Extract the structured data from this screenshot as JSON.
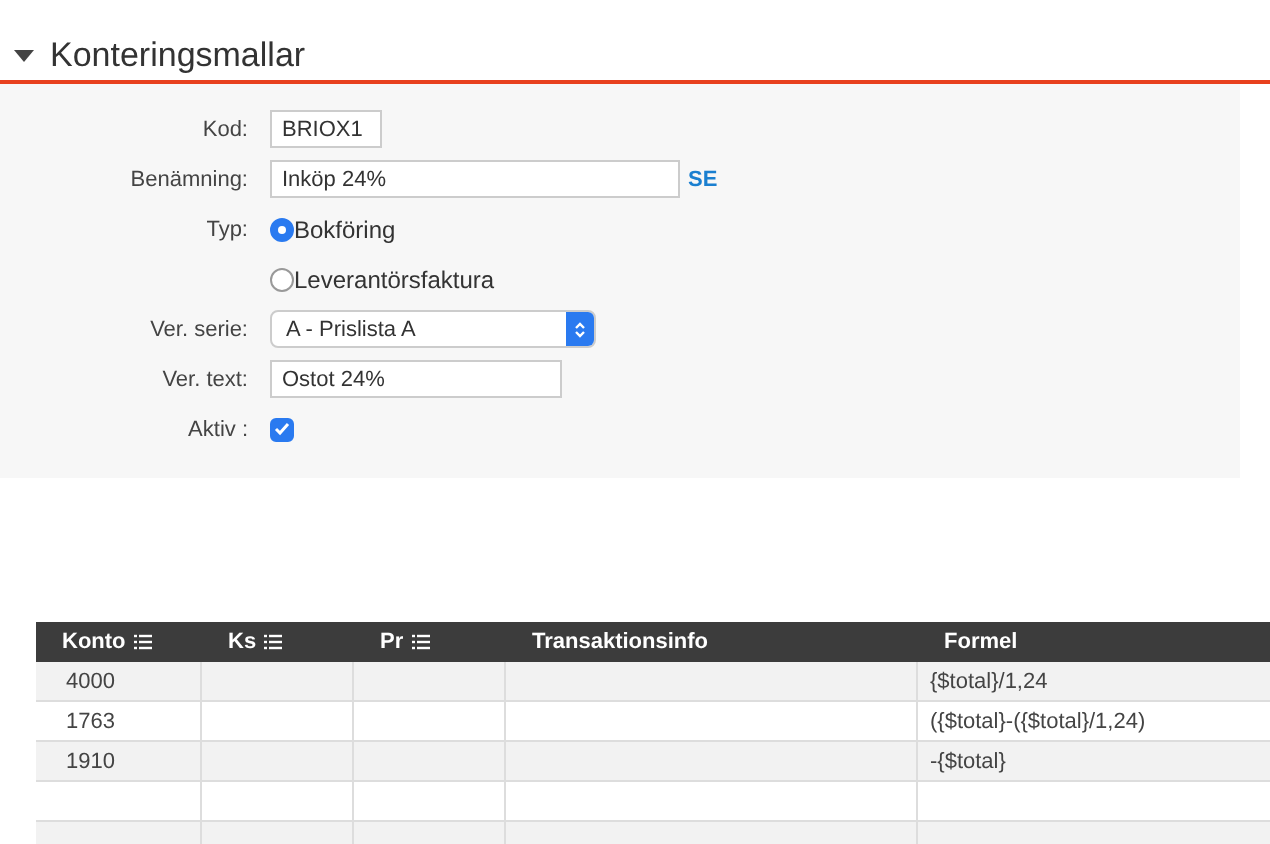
{
  "section": {
    "title": "Konteringsmallar",
    "expanded": true
  },
  "form": {
    "kod": {
      "label": "Kod:",
      "value": "BRIOX1"
    },
    "benamning": {
      "label": "Benämning:",
      "value": "Inköp 24%",
      "language": "SE"
    },
    "typ": {
      "label": "Typ:",
      "options": [
        {
          "label": "Bokföring",
          "selected": true
        },
        {
          "label": "Leverantörsfaktura",
          "selected": false
        }
      ]
    },
    "ver_serie": {
      "label": "Ver. serie:",
      "value": "A - Prislista A"
    },
    "ver_text": {
      "label": "Ver. text:",
      "value": "Ostot 24%"
    },
    "aktiv": {
      "label": "Aktiv :",
      "checked": true
    }
  },
  "table": {
    "columns": [
      {
        "label": "Konto",
        "list_icon": true
      },
      {
        "label": "Ks",
        "list_icon": true
      },
      {
        "label": "Pr",
        "list_icon": true
      },
      {
        "label": "Transaktionsinfo",
        "list_icon": false
      },
      {
        "label": "Formel",
        "list_icon": false
      }
    ],
    "rows": [
      {
        "konto": "4000",
        "formel": "{$total}/1,24"
      },
      {
        "konto": "1763",
        "formel": "({$total}-({$total}/1,24)"
      },
      {
        "konto": "1910",
        "formel": "-{$total}"
      }
    ]
  }
}
